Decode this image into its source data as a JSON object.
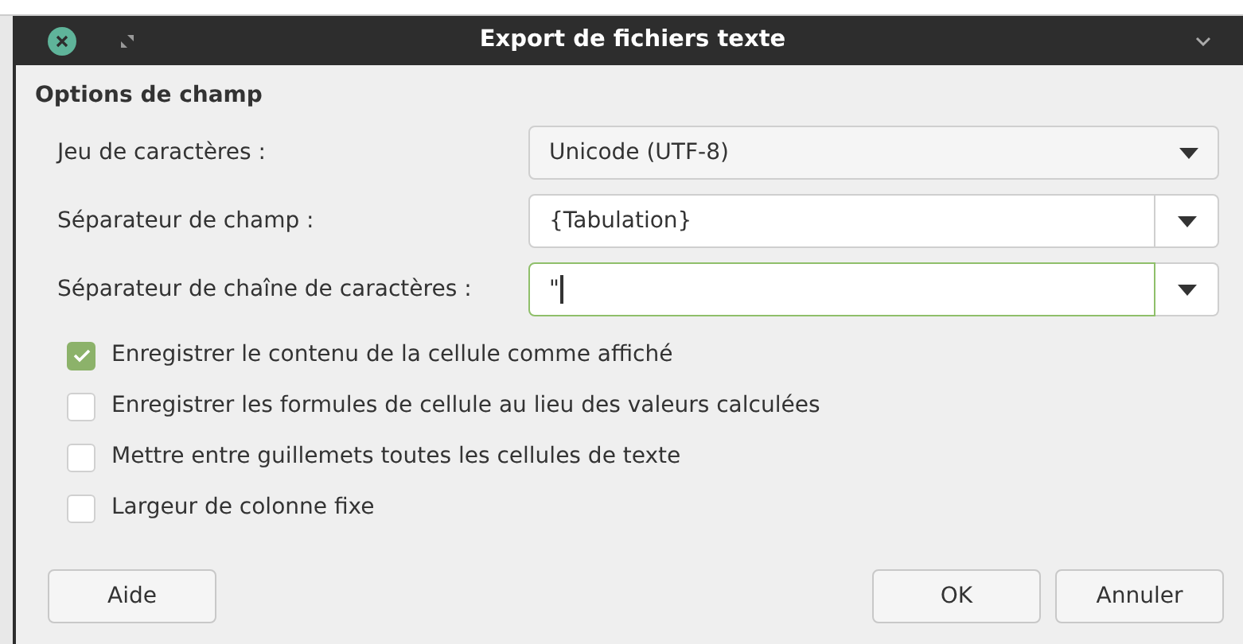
{
  "window": {
    "title": "Export de fichiers texte"
  },
  "section": {
    "title": "Options de champ"
  },
  "fields": [
    {
      "label": "Jeu de caractères :",
      "kind": "select",
      "value": "Unicode (UTF-8)",
      "focused": false
    },
    {
      "label": "Séparateur de champ :",
      "kind": "combo",
      "value": "{Tabulation}",
      "focused": false
    },
    {
      "label": "Séparateur de chaîne de caractères :",
      "kind": "combo",
      "value": "\"",
      "focused": true
    }
  ],
  "options": [
    {
      "label": "Enregistrer le contenu de la cellule comme affiché",
      "checked": true
    },
    {
      "label": "Enregistrer les formules de cellule au lieu des valeurs calculées",
      "checked": false
    },
    {
      "label": "Mettre entre guillemets toutes les cellules de texte",
      "checked": false
    },
    {
      "label": "Largeur de colonne fixe",
      "checked": false
    }
  ],
  "buttons": {
    "left": [
      "Aide"
    ],
    "right": [
      "OK",
      "Annuler"
    ]
  }
}
